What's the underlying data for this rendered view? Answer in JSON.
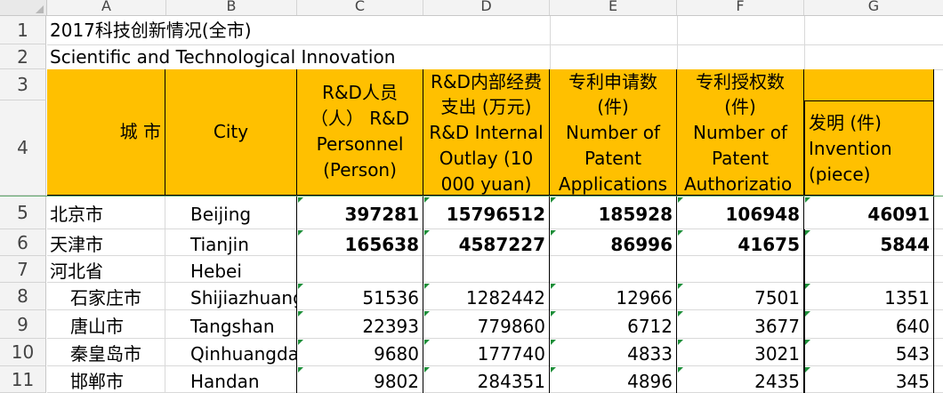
{
  "columns": [
    "A",
    "B",
    "C",
    "D",
    "E",
    "F",
    "G"
  ],
  "rows": [
    "1",
    "2",
    "3",
    "4",
    "5",
    "6",
    "7",
    "8",
    "9",
    "10",
    "11"
  ],
  "title_cn": "2017科技创新情况(全市)",
  "title_en": "Scientific and Technological Innovation",
  "header": {
    "city_cn": "城 市",
    "city_en": "City",
    "rd_personnel": [
      "R&D人员",
      "（人） R&D",
      "Personnel",
      "(Person)"
    ],
    "rd_outlay": [
      "R&D内部经费",
      "支出 (万元)",
      "R&D Internal",
      "Outlay (10",
      "000 yuan)"
    ],
    "patent_app": [
      "专利申请数",
      "(件)",
      "Number of",
      "Patent",
      "Applications"
    ],
    "patent_auth": [
      "专利授权数",
      "(件)",
      "Number of",
      "Patent",
      "Authorizatio"
    ],
    "invention": [
      "发明 (件)",
      "Invention",
      "(piece)"
    ]
  },
  "data_rows": [
    {
      "cn": "北京市",
      "en": "Beijing",
      "c": "397281",
      "d": "15796512",
      "e": "185928",
      "f": "106948",
      "g": "46091",
      "bold": true
    },
    {
      "cn": "天津市",
      "en": "Tianjin",
      "c": "165638",
      "d": "4587227",
      "e": "86996",
      "f": "41675",
      "g": "5844",
      "bold": true
    },
    {
      "cn": "河北省",
      "en": "Hebei",
      "c": "",
      "d": "",
      "e": "",
      "f": "",
      "g": "",
      "bold": false
    },
    {
      "cn": "石家庄市",
      "en": "Shijiazhuang",
      "c": "51536",
      "d": "1282442",
      "e": "12966",
      "f": "7501",
      "g": "1351",
      "bold": false
    },
    {
      "cn": "唐山市",
      "en": "Tangshan",
      "c": "22393",
      "d": "779860",
      "e": "6712",
      "f": "3677",
      "g": "640",
      "bold": false
    },
    {
      "cn": "秦皇岛市",
      "en": "Qinhuangdao",
      "c": "9680",
      "d": "177740",
      "e": "4833",
      "f": "3021",
      "g": "543",
      "bold": false
    },
    {
      "cn": "邯郸市",
      "en": "Handan",
      "c": "9802",
      "d": "284351",
      "e": "4896",
      "f": "2435",
      "g": "345",
      "bold": false
    }
  ],
  "colors": {
    "header_fill": "#ffc000",
    "marker": "#1e8f3a"
  }
}
